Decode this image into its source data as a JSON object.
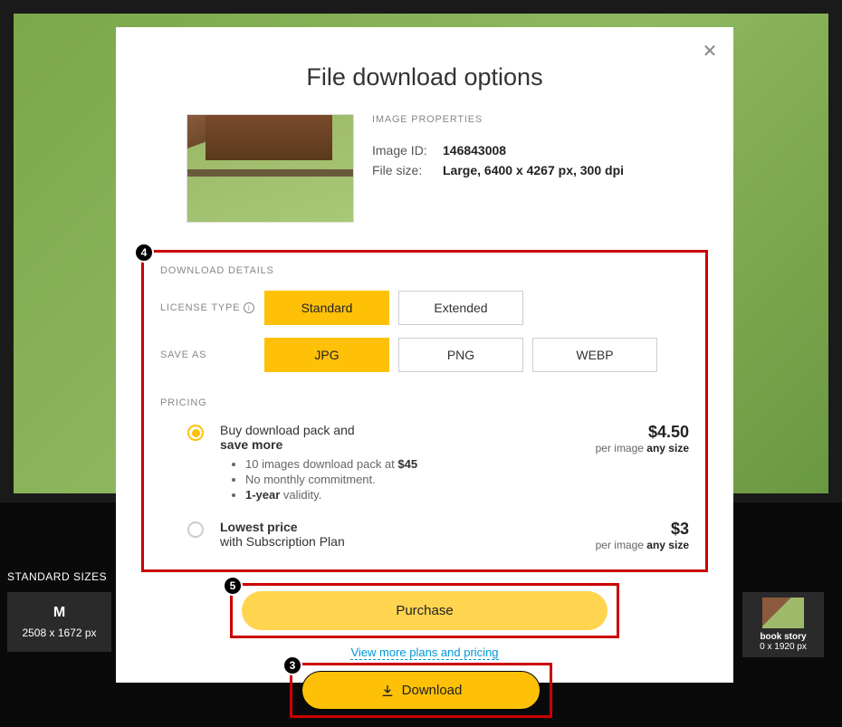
{
  "modal": {
    "title": "File download options",
    "props_header": "IMAGE PROPERTIES",
    "image_id_label": "Image ID:",
    "image_id": "146843008",
    "filesize_label": "File size:",
    "filesize": "Large, 6400 x 4267 px, 300 dpi"
  },
  "details": {
    "header": "DOWNLOAD DETAILS",
    "license_label": "LICENSE TYPE",
    "license_options": [
      "Standard",
      "Extended"
    ],
    "saveas_label": "SAVE AS",
    "saveas_options": [
      "JPG",
      "PNG",
      "WEBP"
    ],
    "pricing_label": "PRICING"
  },
  "pricing": {
    "opt1_line1": "Buy download pack and",
    "opt1_line2": "save more",
    "opt1_bullet1_pre": "10 images download pack at ",
    "opt1_bullet1_bold": "$45",
    "opt1_bullet2": "No monthly commitment.",
    "opt1_bullet3_bold": "1-year",
    "opt1_bullet3_post": " validity.",
    "opt1_price": "$4.50",
    "opt1_sub_pre": "per image ",
    "opt1_sub_bold": "any size",
    "opt2_line1": "Lowest price",
    "opt2_line2": "with Subscription Plan",
    "opt2_price": "$3",
    "opt2_sub_pre": "per image ",
    "opt2_sub_bold": "any size"
  },
  "actions": {
    "purchase": "Purchase",
    "plans_link": "View more plans and pricing",
    "download": "Download"
  },
  "strip": {
    "label": "STANDARD SIZES",
    "m": "M",
    "m_dim": "2508 x 1672 px",
    "story": "book story",
    "story_dim": "0 x 1920 px"
  },
  "steps": {
    "s3": "3",
    "s4": "4",
    "s5": "5"
  }
}
